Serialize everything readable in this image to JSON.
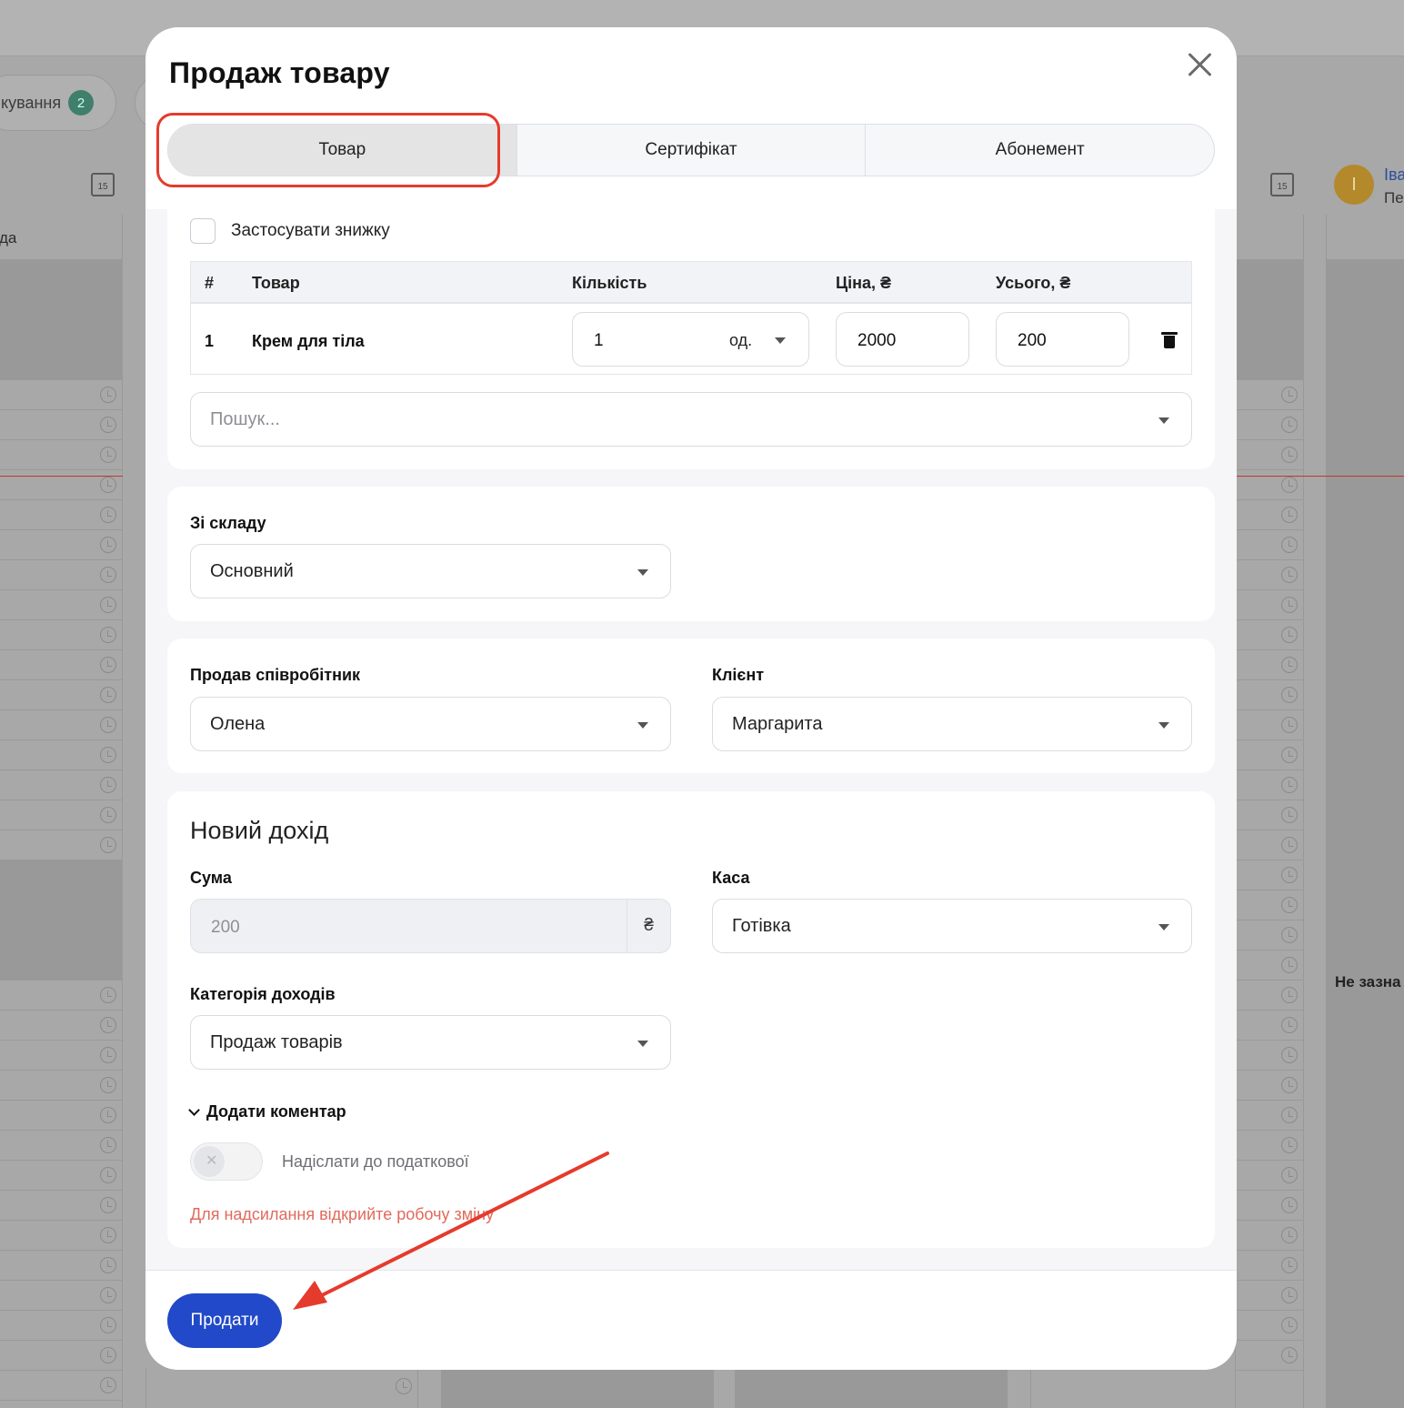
{
  "background": {
    "pill_label": "кування",
    "pill_badge": "2",
    "left_column_header": "да",
    "calendar_day": "15",
    "avatar_initial": "І",
    "staff_name_fragment": "Іва",
    "staff_sub_fragment": "Пе",
    "note_fragment": "Не зазна"
  },
  "modal": {
    "title": "Продаж товару",
    "tabs": [
      {
        "label": "Товар",
        "active": true
      },
      {
        "label": "Сертифікат",
        "active": false
      },
      {
        "label": "Абонемент",
        "active": false
      }
    ],
    "discount_label": "Застосувати знижку",
    "table": {
      "headers": [
        "#",
        "Товар",
        "Кількість",
        "Ціна, ₴",
        "Усього, ₴"
      ],
      "rows": [
        {
          "index": "1",
          "product": "Крем для тіла",
          "quantity": "1",
          "unit": "од.",
          "price": "2000",
          "total": "200"
        }
      ]
    },
    "search_placeholder": "Пошук...",
    "warehouse": {
      "label": "Зі складу",
      "value": "Основний"
    },
    "seller": {
      "label": "Продав співробітник",
      "value": "Олена"
    },
    "client": {
      "label": "Клієнт",
      "value": "Маргарита"
    },
    "income": {
      "title": "Новий дохід",
      "sum_label": "Сума",
      "sum_value": "200",
      "currency": "₴",
      "cash_label": "Каса",
      "cash_value": "Готівка",
      "category_label": "Категорія доходів",
      "category_value": "Продаж товарів",
      "comment_label": "Додати коментар",
      "tax_switch_label": "Надіслати до податкової",
      "tax_switch_on": false,
      "warning": "Для надсилання відкрийте робочу зміну"
    },
    "submit_label": "Продати"
  },
  "colors": {
    "primary": "#2149c9",
    "highlight": "#e53b2c",
    "warning_text": "#e06a5b",
    "overlay": "#a8a8a8"
  }
}
